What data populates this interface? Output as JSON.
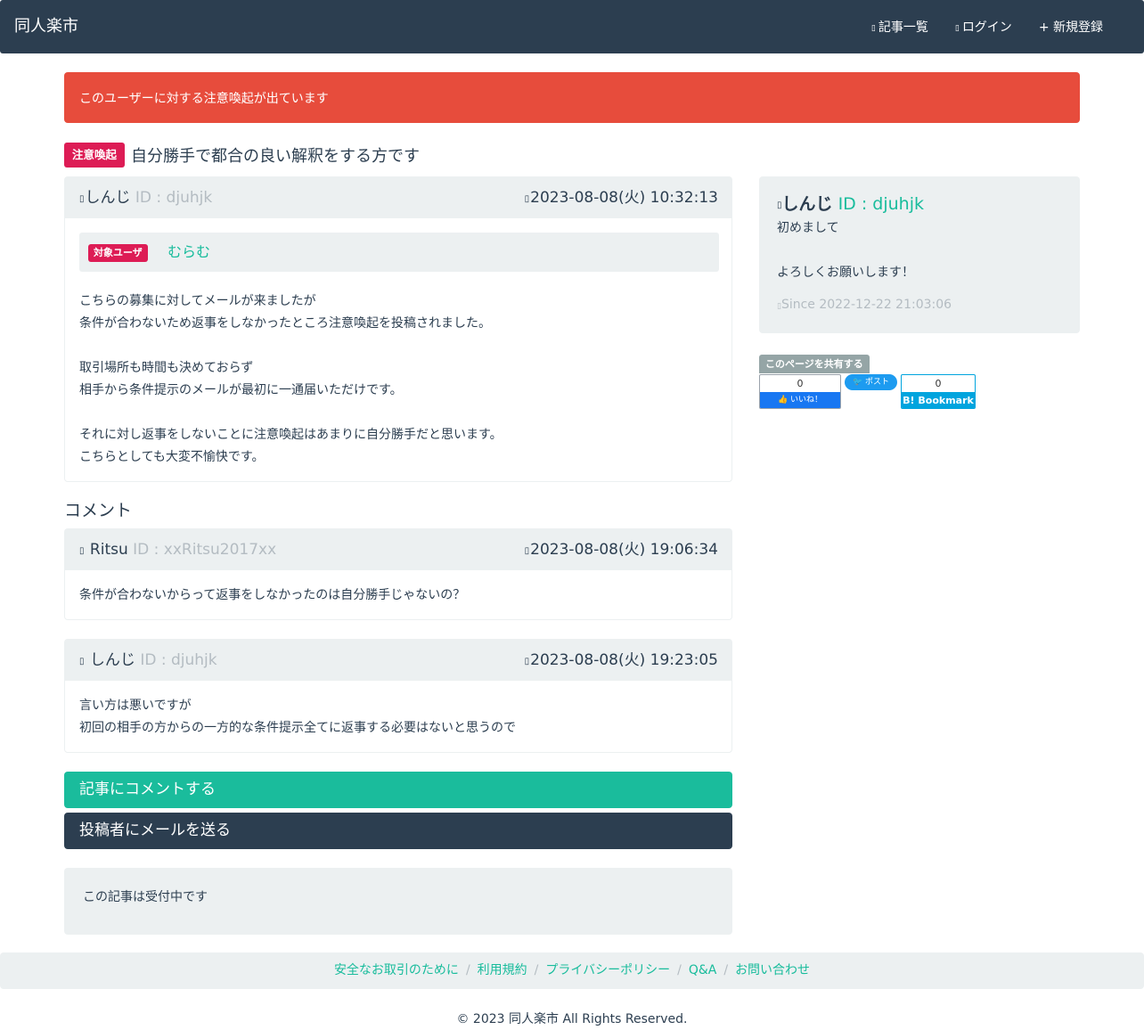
{
  "header": {
    "brand": "同人楽市",
    "nav": [
      {
        "icon": "▯",
        "label": "記事一覧"
      },
      {
        "icon": "▯",
        "label": "ログイン"
      },
      {
        "icon": "+",
        "label": "新規登録"
      }
    ]
  },
  "alert": "このユーザーに対する注意喚起が出ています",
  "article": {
    "badge": "注意喚起",
    "title": "自分勝手で都合の良い解釈をする方です",
    "author": "しんじ",
    "author_id": "ID : djuhjk",
    "date": "2023-08-08(火) 10:32:13",
    "target_badge": "対象ユーザ",
    "target_user": "むらむ",
    "body": [
      "こちらの募集に対してメールが来ましたが",
      "条件が合わないため返事をしなかったところ注意喚起を投稿されました。",
      "",
      "取引場所も時間も決めておらず",
      "相手から条件提示のメールが最初に一通届いただけです。",
      "",
      "それに対し返事をしないことに注意喚起はあまりに自分勝手だと思います。",
      "こちらとしても大変不愉快です。"
    ]
  },
  "comments_title": "コメント",
  "comments": [
    {
      "author": "Ritsu",
      "author_id": "ID : xxRitsu2017xx",
      "date": "2023-08-08(火) 19:06:34",
      "body": [
        "条件が合わないからって返事をしなかったのは自分勝手じゃないの？"
      ]
    },
    {
      "author": "しんじ",
      "author_id": "ID : djuhjk",
      "date": "2023-08-08(火) 19:23:05",
      "body": [
        "言い方は悪いですが",
        "初回の相手の方からの一方的な条件提示全てに返事する必要はないと思うので"
      ]
    }
  ],
  "buttons": {
    "comment": "記事にコメントする",
    "mail": "投稿者にメールを送る"
  },
  "status": "この記事は受付中です",
  "profile": {
    "name": "しんじ",
    "id": "ID : djuhjk",
    "line1": "初めまして",
    "line2": "よろしくお願いします！",
    "since": "Since 2022-12-22 21:03:06"
  },
  "share": {
    "label": "このページを共有する",
    "fb_count": "0",
    "fb_label": "👍 いいね！",
    "tw_label": "ポスト",
    "hb_count": "0",
    "hb_label": "B! Bookmark"
  },
  "footer": {
    "links": [
      "安全なお取引のために",
      "利用規約",
      "プライバシーポリシー",
      "Q&A",
      "お問い合わせ"
    ],
    "copyright": "© 2023 同人楽市 All Rights Reserved."
  },
  "colors": {
    "navbar": "#2c3e50",
    "alert": "#e74c3c",
    "accent": "#18bc9c",
    "badge": "#dd1c55",
    "light": "#ecf0f1"
  }
}
